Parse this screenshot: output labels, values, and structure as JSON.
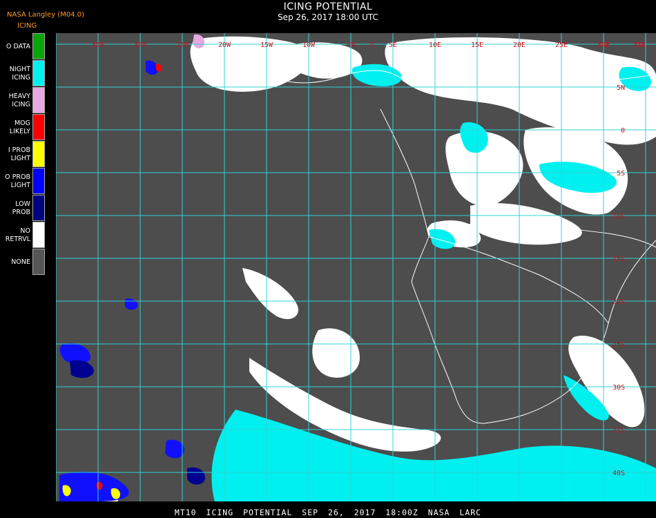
{
  "header": {
    "source": "NASA Langley (M04.0)",
    "product": "ICING",
    "title": "ICING POTENTIAL",
    "datetime": "Sep 26, 2017 18:00 UTC"
  },
  "legend": [
    {
      "label": "O DATA",
      "color": "#0aa50a"
    },
    {
      "label": "NIGHT\nICING",
      "color": "#00f0f0"
    },
    {
      "label": "HEAVY\nICING",
      "color": "#e6a8e0"
    },
    {
      "label": "MOG\nLIKELY",
      "color": "#ff0000"
    },
    {
      "label": "I PROB\nLIGHT",
      "color": "#ffff00"
    },
    {
      "label": "O PROB\nLIGHT",
      "color": "#0000ff"
    },
    {
      "label": "LOW\nPROB",
      "color": "#000080"
    },
    {
      "label": "NO\nRETRVL",
      "color": "#ffffff"
    },
    {
      "label": "NONE",
      "color": "#555555"
    }
  ],
  "map": {
    "background": "#4d4d4d",
    "grid_color": "#2fd3d6",
    "label_color": "#c8141e",
    "top_labels": [
      "35W",
      "30W",
      "25W",
      "20W",
      "15W",
      "10W",
      "5W",
      "0",
      "5E",
      "10E",
      "15E",
      "20E",
      "25E",
      "30E",
      "35E"
    ],
    "right_labels": [
      "5N",
      "0",
      "5S",
      "10S",
      "15S",
      "20S",
      "25S",
      "30S",
      "35S",
      "40S"
    ]
  },
  "footer": "MT10 ICING POTENTIAL SEP 26, 2017 18:00Z NASA LARC"
}
